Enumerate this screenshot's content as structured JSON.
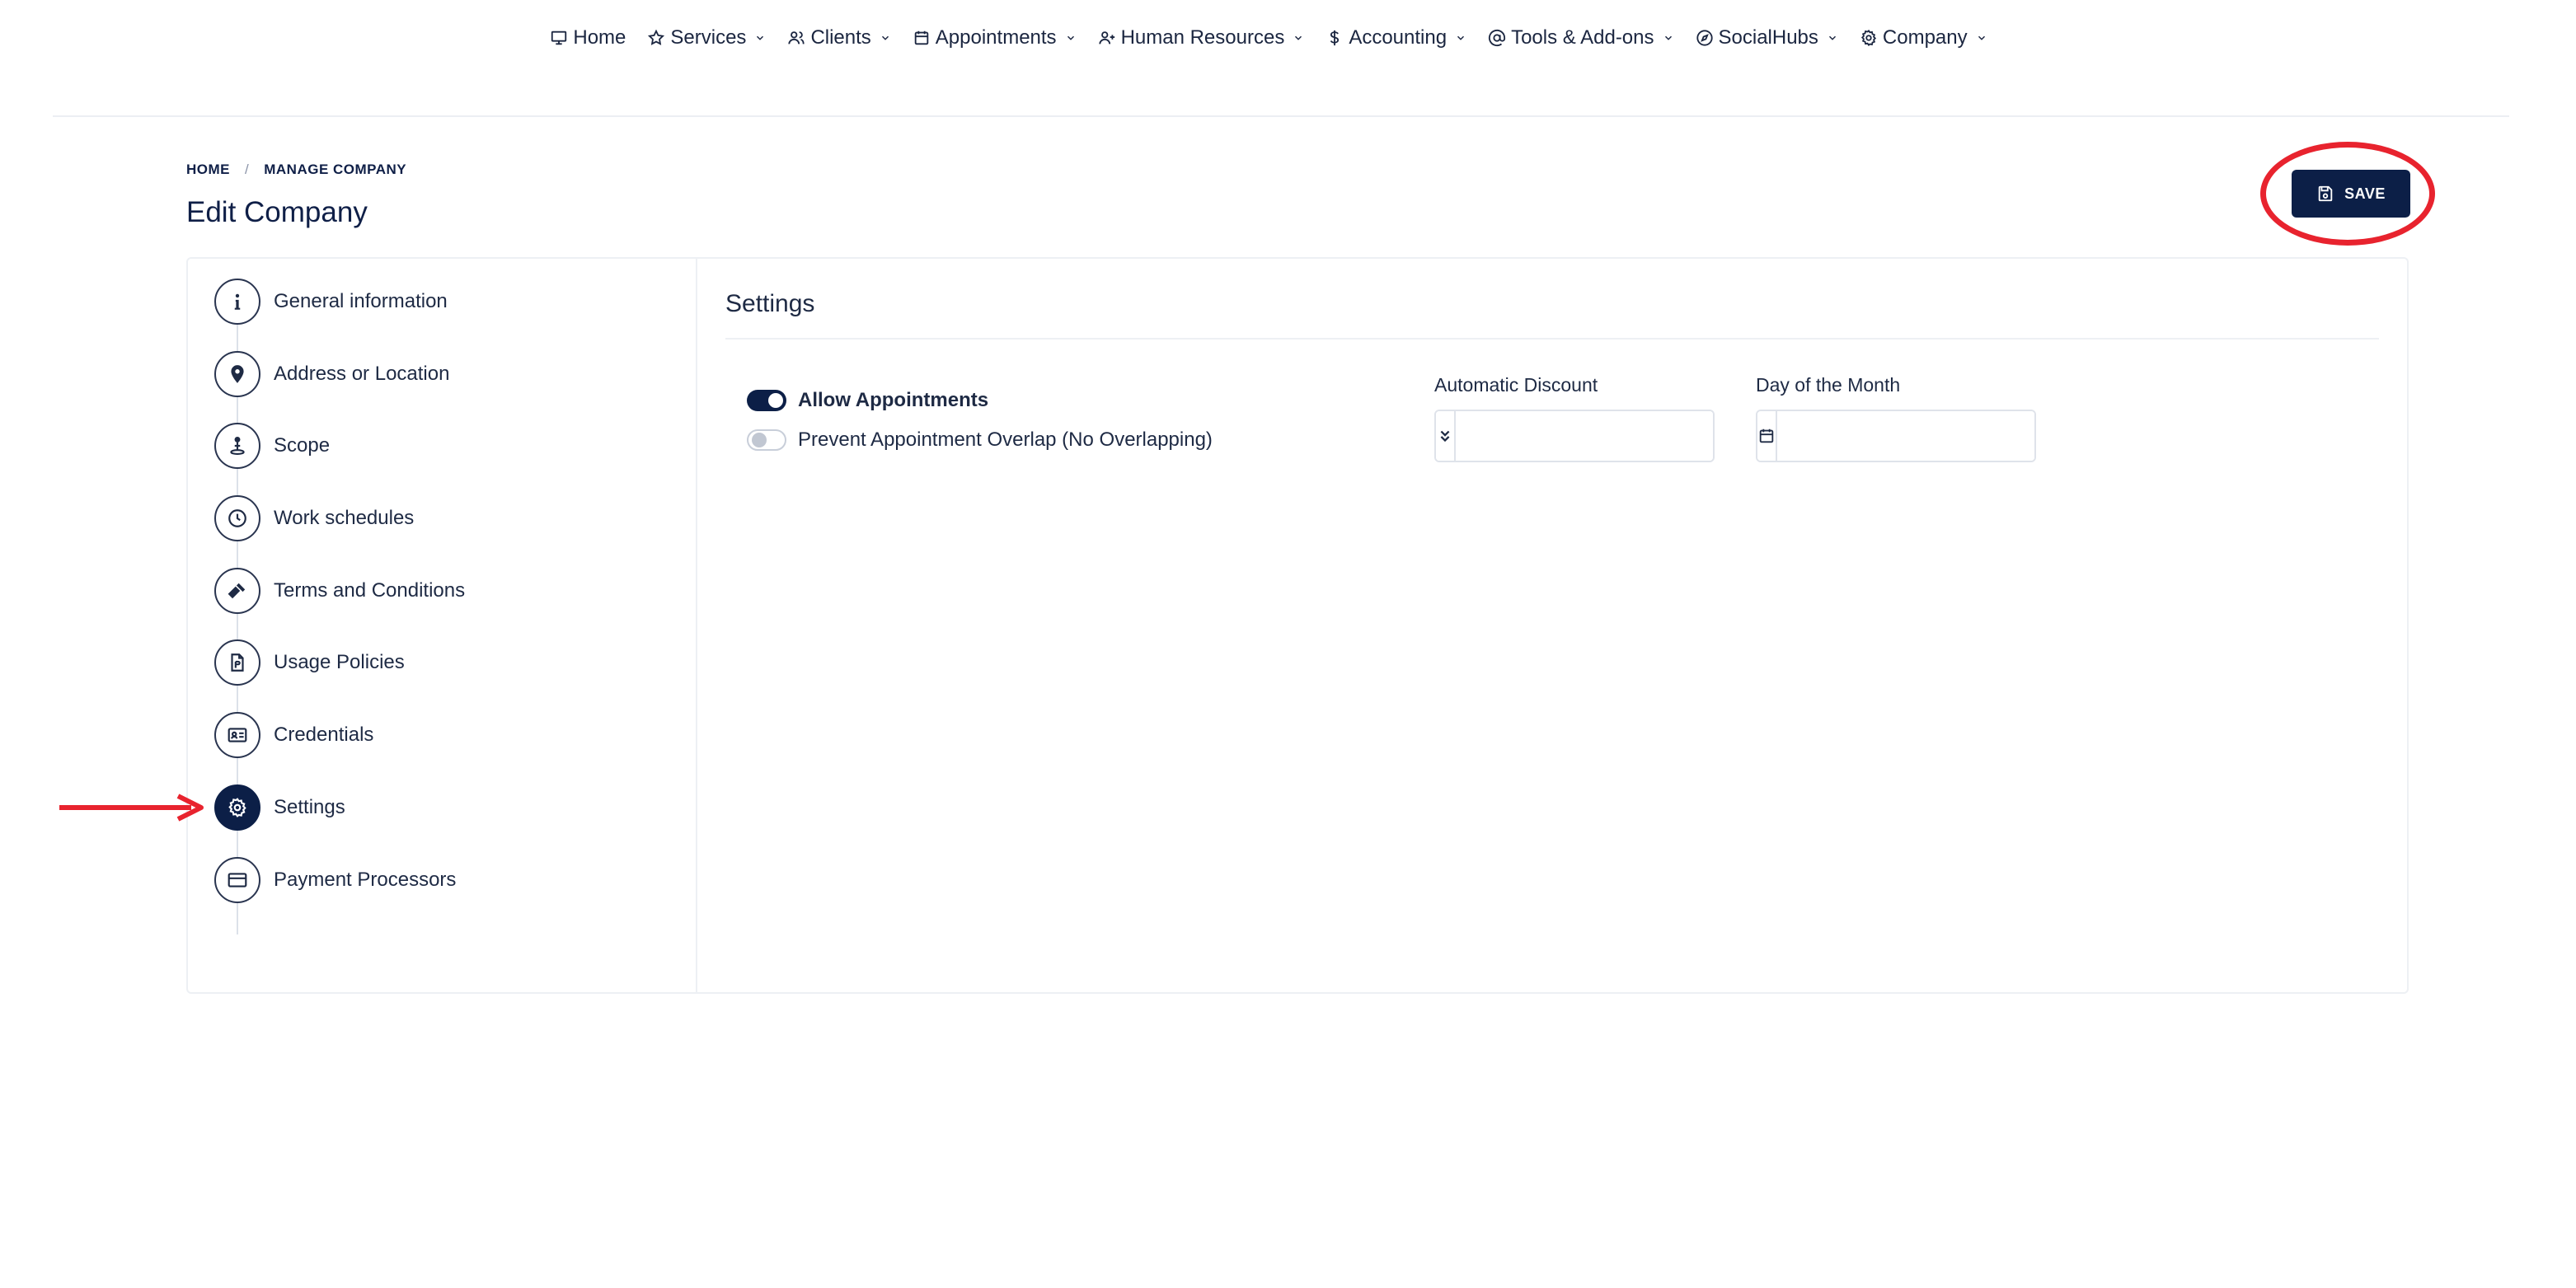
{
  "nav": {
    "items": [
      {
        "label": "Home",
        "icon": "monitor-icon",
        "dropdown": false
      },
      {
        "label": "Services",
        "icon": "star-icon",
        "dropdown": true
      },
      {
        "label": "Clients",
        "icon": "users-icon",
        "dropdown": true
      },
      {
        "label": "Appointments",
        "icon": "calendar-icon",
        "dropdown": true
      },
      {
        "label": "Human Resources",
        "icon": "user-plus-icon",
        "dropdown": true
      },
      {
        "label": "Accounting",
        "icon": "dollar-icon",
        "dropdown": true
      },
      {
        "label": "Tools & Add-ons",
        "icon": "at-sign-icon",
        "dropdown": true
      },
      {
        "label": "SocialHubs",
        "icon": "compass-icon",
        "dropdown": true
      },
      {
        "label": "Company",
        "icon": "gear-icon",
        "dropdown": true
      }
    ]
  },
  "breadcrumb": {
    "home": "HOME",
    "separator": "/",
    "current": "MANAGE COMPANY"
  },
  "page": {
    "title": "Edit Company"
  },
  "toolbar": {
    "save_label": "SAVE"
  },
  "sidebar": {
    "steps": [
      {
        "label": "General information",
        "icon": "info-icon"
      },
      {
        "label": "Address or Location",
        "icon": "map-pin-icon"
      },
      {
        "label": "Scope",
        "icon": "scope-person-icon"
      },
      {
        "label": "Work schedules",
        "icon": "clock-icon"
      },
      {
        "label": "Terms and Conditions",
        "icon": "gavel-icon"
      },
      {
        "label": "Usage Policies",
        "icon": "document-icon"
      },
      {
        "label": "Credentials",
        "icon": "id-card-icon"
      },
      {
        "label": "Settings",
        "icon": "gear-icon",
        "active": true
      },
      {
        "label": "Payment Processors",
        "icon": "credit-card-icon"
      }
    ]
  },
  "settings": {
    "title": "Settings",
    "allow_appointments": {
      "label": "Allow Appointments",
      "checked": true
    },
    "prevent_overlap": {
      "label": "Prevent Appointment Overlap (No Overlapping)",
      "checked": false
    },
    "automatic_discount": {
      "label": "Automatic Discount",
      "value": "",
      "icon": "double-chevron-down-icon"
    },
    "day_of_month": {
      "label": "Day of the Month",
      "value": "",
      "icon": "calendar-icon"
    }
  },
  "colors": {
    "primary": "#0c1f47",
    "annotation": "#e8232e",
    "border": "#edf0f4"
  }
}
